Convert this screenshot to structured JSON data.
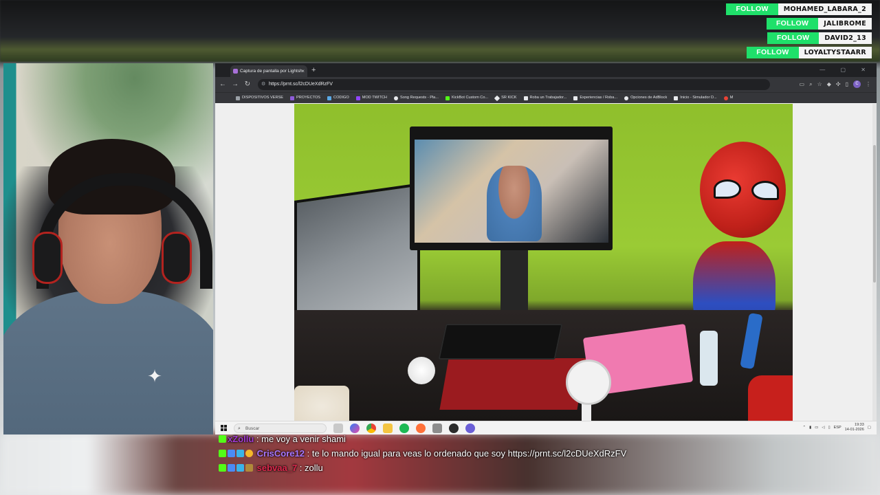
{
  "follows": [
    {
      "label": "FOLLOW",
      "name": "MOHAMED_LABARA_2"
    },
    {
      "label": "FOLLOW",
      "name": "JALIBROME"
    },
    {
      "label": "FOLLOW",
      "name": "DAVID2_13"
    },
    {
      "label": "FOLLOW",
      "name": "LOYALTYSTAARR"
    }
  ],
  "browser": {
    "tab_title": "Captura de pantalla por Lightsh",
    "tab_close": "×",
    "new_tab": "+",
    "window_controls": "— ▢ ✕",
    "url": "https://prnt.sc/l2cDUeXdRzFV",
    "nav": {
      "back": "←",
      "forward": "→",
      "reload": "↻"
    },
    "bookmarks": [
      {
        "label": "DISPOSITIVOS VERSE",
        "color": "#9aa0a6"
      },
      {
        "label": "PROYECTOS",
        "color": "#8e5cd9"
      },
      {
        "label": "CODIGO",
        "color": "#5aa9e6"
      },
      {
        "label": "MOD TWITCH",
        "color": "#9146ff"
      },
      {
        "label": "Song Requests - Pla...",
        "color": "#e8eaed"
      },
      {
        "label": "KickBot Custom Co...",
        "color": "#53fc18"
      },
      {
        "label": "SR KICK",
        "color": "#e8eaed"
      },
      {
        "label": "Roba un Trabajador...",
        "color": "#e8eaed"
      },
      {
        "label": "Experiencias / Roba...",
        "color": "#e8eaed"
      },
      {
        "label": "Opciones de AdBlock",
        "color": "#e8eaed"
      },
      {
        "label": "Inicio - Simulador D...",
        "color": "#e8eaed"
      },
      {
        "label": "M",
        "color": "#ea4335"
      }
    ],
    "profile_initial": "C"
  },
  "taskbar": {
    "search_placeholder": "Buscar",
    "lang": "ESP",
    "time": "19:33",
    "date": "14-01-2026"
  },
  "chat": [
    {
      "user": "xZollu",
      "sep": " : ",
      "text": "me voy a venir shami"
    },
    {
      "user": "CrisCore12",
      "sep": " : ",
      "text": "te lo mando igual para veas lo ordenado que soy https://prnt.sc/l2cDUeXdRzFV"
    },
    {
      "user": "sebvaa_7",
      "sep": " : ",
      "text": "zollu"
    }
  ]
}
